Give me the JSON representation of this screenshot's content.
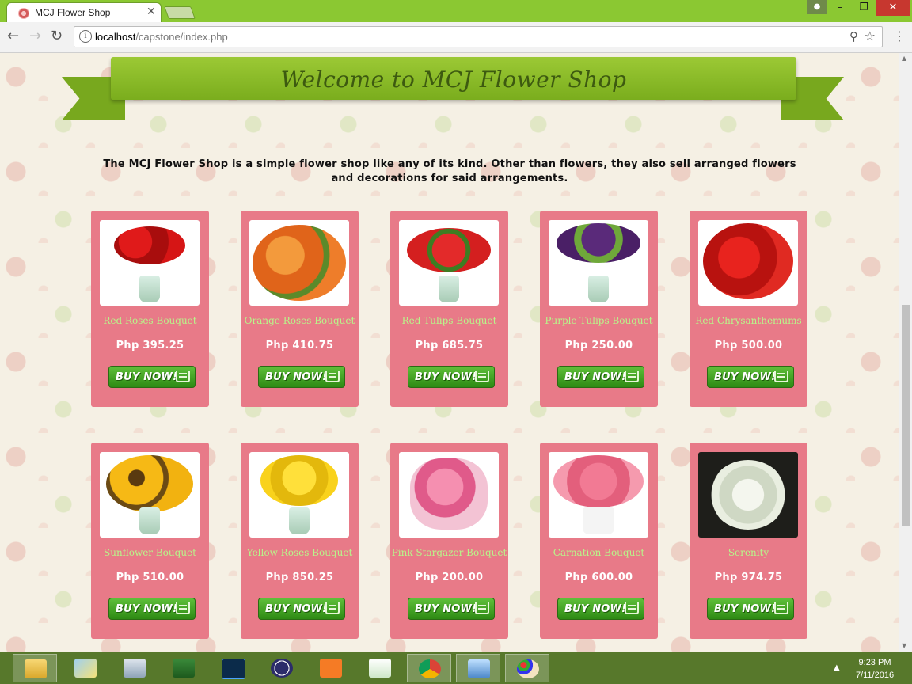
{
  "browser": {
    "tab_title": "MCJ Flower Shop",
    "tab_close": "✕",
    "url_host": "localhost",
    "url_path": "/capstone/index.php"
  },
  "page": {
    "banner_title": "Welcome to MCJ Flower Shop",
    "intro": "The MCJ Flower Shop is a simple flower shop like any of its kind. Other than flowers, they also sell arranged flowers and decorations for said arrangements.",
    "buy_label": "BUY NOW!",
    "products": [
      {
        "name": "Red Roses Bouquet",
        "price": "Php 395.25"
      },
      {
        "name": "Orange Roses Bouquet",
        "price": "Php 410.75"
      },
      {
        "name": "Red Tulips Bouquet",
        "price": "Php 685.75"
      },
      {
        "name": "Purple Tulips Bouquet",
        "price": "Php 250.00"
      },
      {
        "name": "Red Chrysanthemums",
        "price": "Php 500.00"
      },
      {
        "name": "Sunflower Bouquet",
        "price": "Php 510.00"
      },
      {
        "name": "Yellow Roses Bouquet",
        "price": "Php 850.25"
      },
      {
        "name": "Pink Stargazer Bouquet",
        "price": "Php 200.00"
      },
      {
        "name": "Carnation Bouquet",
        "price": "Php 600.00"
      },
      {
        "name": "Serenity",
        "price": "Php 974.75"
      }
    ]
  },
  "taskbar": {
    "time": "9:23 PM",
    "date": "7/11/2016"
  },
  "colors": {
    "chrome_frame": "#8bc832",
    "card": "#e87a88",
    "product_name": "#b8f58a",
    "buy_button": "#3a9a1c",
    "banner": "#8bbd2a"
  }
}
